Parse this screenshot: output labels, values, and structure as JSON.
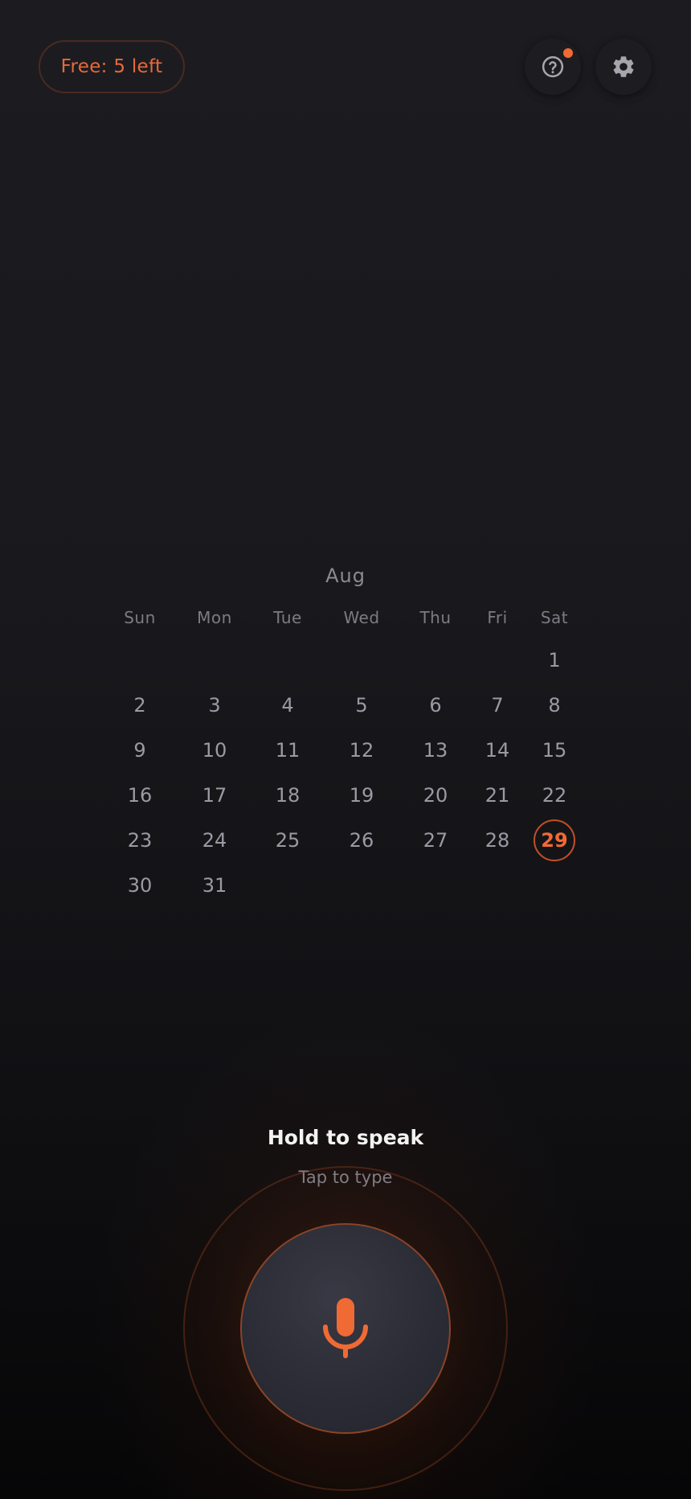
{
  "header": {
    "free_label": "Free: 5 left",
    "help_icon": "help-circle-icon",
    "settings_icon": "gear-icon",
    "notification_dot": true
  },
  "calendar": {
    "month": "Aug",
    "weekdays": [
      "Sun",
      "Mon",
      "Tue",
      "Wed",
      "Thu",
      "Fri",
      "Sat"
    ],
    "weeks": [
      [
        "",
        "",
        "",
        "",
        "",
        "",
        "1"
      ],
      [
        "2",
        "3",
        "4",
        "5",
        "6",
        "7",
        "8"
      ],
      [
        "9",
        "10",
        "11",
        "12",
        "13",
        "14",
        "15"
      ],
      [
        "16",
        "17",
        "18",
        "19",
        "20",
        "21",
        "22"
      ],
      [
        "23",
        "24",
        "25",
        "26",
        "27",
        "28",
        "29"
      ],
      [
        "30",
        "31",
        "",
        "",
        "",
        "",
        ""
      ]
    ],
    "today": "29"
  },
  "voice": {
    "hold_label": "Hold to speak",
    "tap_label": "Tap to type",
    "mic_icon": "microphone-icon"
  },
  "colors": {
    "accent": "#f06a34",
    "background": "#1a1a1e",
    "text_muted": "#9a9aa3"
  }
}
